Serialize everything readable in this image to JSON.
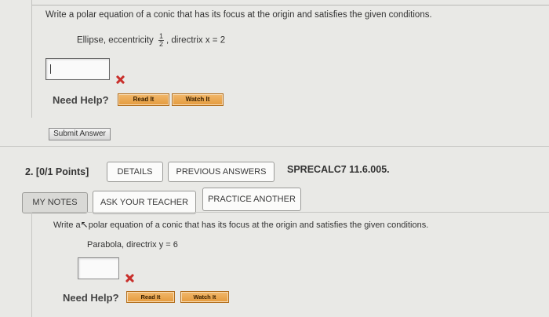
{
  "question1": {
    "prompt": "Write a polar equation of a conic that has its focus at the origin and satisfies the given conditions.",
    "conditions_prefix": "Ellipse, eccentricity",
    "eccentricity_num": "1",
    "eccentricity_den": "2",
    "conditions_suffix": ", directrix x = 2",
    "answer_value": "",
    "need_help": "Need Help?",
    "read_it": "Read It",
    "watch_it": "Watch It",
    "submit": "Submit Answer"
  },
  "question2": {
    "number": "2.",
    "points": "[0/1 Points]",
    "details": "DETAILS",
    "previous_answers": "PREVIOUS ANSWERS",
    "code": "SPRECALC7 11.6.005.",
    "my_notes": "MY NOTES",
    "ask_teacher": "ASK YOUR TEACHER",
    "practice_another": "PRACTICE ANOTHER",
    "prompt_start": "Write a",
    "prompt_rest": "polar equation of a conic that has its focus at the origin and satisfies the given conditions.",
    "conditions": "Parabola, directrix y = 6",
    "answer_value": "",
    "need_help": "Need Help?",
    "read_it": "Read It",
    "watch_it": "Watch It"
  },
  "colors": {
    "wrong": "#c9302c",
    "help_button": "#e8a24a",
    "background": "#e9e9e6"
  }
}
